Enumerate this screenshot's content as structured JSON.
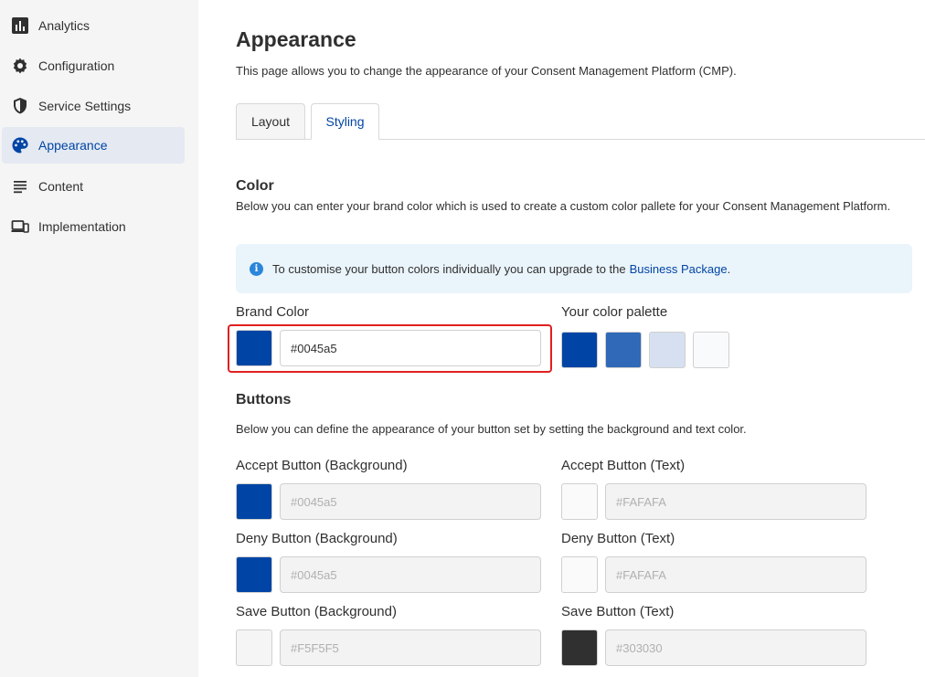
{
  "sidebar": {
    "items": [
      {
        "label": "Analytics",
        "icon": "bar-chart-icon"
      },
      {
        "label": "Configuration",
        "icon": "gear-icon"
      },
      {
        "label": "Service Settings",
        "icon": "shield-icon"
      },
      {
        "label": "Appearance",
        "icon": "palette-icon",
        "active": true
      },
      {
        "label": "Content",
        "icon": "text-lines-icon"
      },
      {
        "label": "Implementation",
        "icon": "devices-icon"
      }
    ]
  },
  "header": {
    "title": "Appearance",
    "description": "This page allows you to change the appearance of your Consent Management Platform (CMP)."
  },
  "tabs": [
    {
      "label": "Layout",
      "active": false
    },
    {
      "label": "Styling",
      "active": true
    }
  ],
  "color_section": {
    "title": "Color",
    "description": "Below you can enter your brand color which is used to create a custom color pallete for your Consent Management Platform.",
    "info_text": "To customise your button colors individually you can upgrade to the",
    "info_link": "Business Package",
    "info_suffix": ".",
    "brand_color_label": "Brand Color",
    "brand_color_value": "#0045a5",
    "palette_label": "Your color palette",
    "palette_colors": [
      "#0045a5",
      "#3069b8",
      "#d6e0f0",
      "#f9fafc"
    ]
  },
  "buttons_section": {
    "title": "Buttons",
    "description": "Below you can define the appearance of your button set by setting the background and text color.",
    "fields": [
      {
        "label": "Accept Button (Background)",
        "value": "#0045a5",
        "swatch": "#0045a5"
      },
      {
        "label": "Accept Button (Text)",
        "value": "#FAFAFA",
        "swatch": "#FAFAFA"
      },
      {
        "label": "Deny Button (Background)",
        "value": "#0045a5",
        "swatch": "#0045a5"
      },
      {
        "label": "Deny Button (Text)",
        "value": "#FAFAFA",
        "swatch": "#FAFAFA"
      },
      {
        "label": "Save Button (Background)",
        "value": "#F5F5F5",
        "swatch": "#F5F5F5"
      },
      {
        "label": "Save Button (Text)",
        "value": "#303030",
        "swatch": "#303030"
      }
    ]
  },
  "colors": {
    "accent": "#0045a5",
    "highlight": "#e02020",
    "info_bg": "#eaf4fb"
  }
}
